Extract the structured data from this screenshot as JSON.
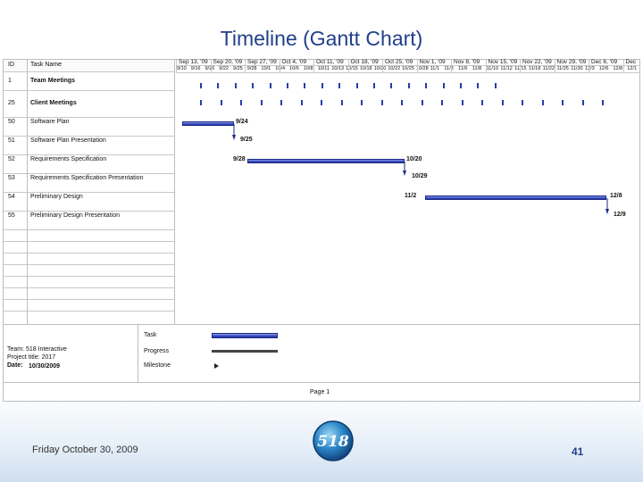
{
  "slide": {
    "title": "Timeline (Gantt Chart)",
    "footer_date": "Friday October 30, 2009",
    "page_number": "41",
    "logo_text": "518"
  },
  "table": {
    "header": {
      "id": "ID",
      "name": "Task Name"
    },
    "rows": [
      {
        "id": "1",
        "name": "Team Meetings"
      },
      {
        "id": "25",
        "name": "Client Meetings"
      },
      {
        "id": "50",
        "name": "Software Plan"
      },
      {
        "id": "51",
        "name": "Software Plan Presentation"
      },
      {
        "id": "52",
        "name": "Requirements Specification"
      },
      {
        "id": "53",
        "name": "Requirements Specification Presentation"
      },
      {
        "id": "54",
        "name": "Preliminary Design"
      },
      {
        "id": "55",
        "name": "Preliminary Design Presentation"
      }
    ]
  },
  "timescale": {
    "weeks": [
      "Sep 13, '09",
      "Sep 20, '09",
      "Sep 27, '09",
      "Oct 4, '09",
      "Oct 11, '09",
      "Oct 18, '09",
      "Oct 25, '09",
      "Nov 1, '09",
      "Nov 8, '09",
      "Nov 15, '09",
      "Nov 22, '09",
      "Nov 29, '09",
      "Dec 6, '09",
      "Dec"
    ],
    "days": [
      "9/10",
      "9/16",
      "9/20",
      "9/22",
      "9/25",
      "9/28",
      "10/1",
      "10/4",
      "10/6",
      "10/8",
      "10/11",
      "10/13",
      "10/15",
      "10/18",
      "10/20",
      "10/22",
      "10/25",
      "10/28",
      "11/1",
      "11/3",
      "11/6",
      "11/8",
      "11/10",
      "11/12",
      "11/15",
      "11/18",
      "11/22",
      "11/25",
      "11/30",
      "12/3",
      "12/6",
      "12/8",
      "12/1"
    ]
  },
  "bar_labels": {
    "software_plan_end": "9/24",
    "software_plan_pres": "9/25",
    "req_spec_start": "9/28",
    "req_spec_end": "10/20",
    "req_spec_pres": "10/29",
    "prelim_start": "11/2",
    "prelim_end": "12/8",
    "prelim_pres": "12/9"
  },
  "legend": {
    "team": "Team: 518 Interactive",
    "project": "Project title: 2017",
    "date_label": "Date:",
    "date_value": "10/30/2009",
    "task": "Task",
    "progress": "Progress",
    "milestone": "Milestone"
  },
  "page_label": "Page 1",
  "colors": {
    "bar": "#3a4fc4",
    "title": "#22408a",
    "progress": "#444444"
  },
  "icons": {
    "milestone": "milestone-arrow-icon"
  }
}
